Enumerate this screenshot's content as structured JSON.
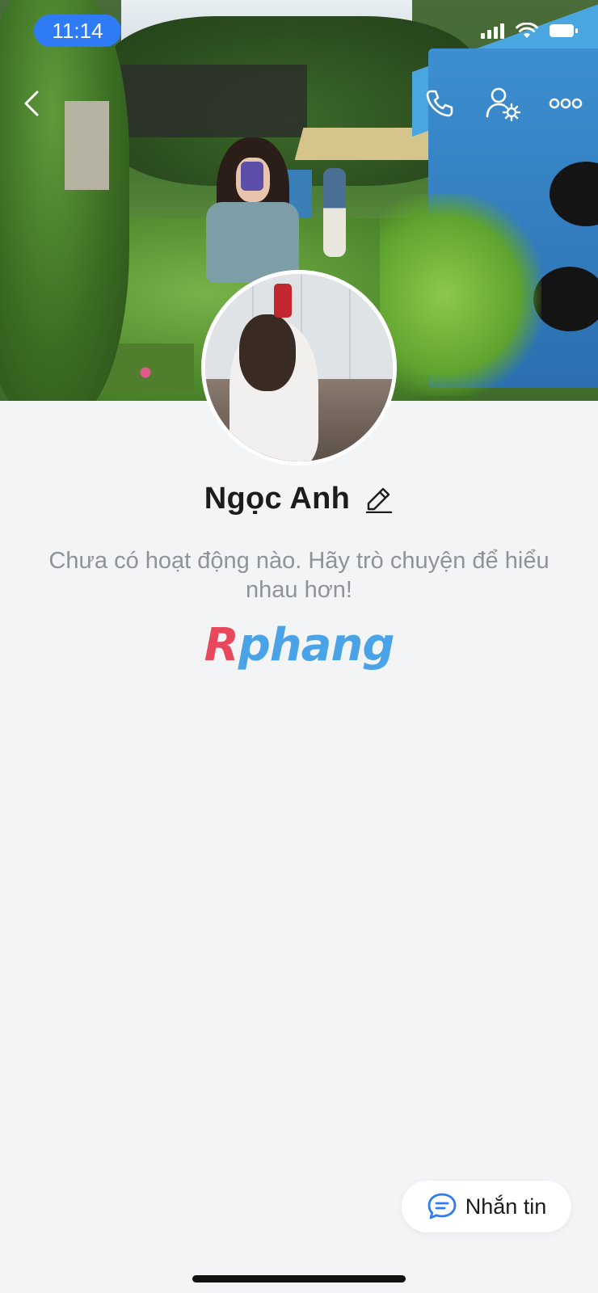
{
  "status_bar": {
    "time": "11:14"
  },
  "top_bar": {
    "icons": [
      "back-icon",
      "phone-call-icon",
      "profile-settings-icon",
      "more-options-icon"
    ]
  },
  "profile": {
    "name": "Ngọc Anh",
    "empty_activity_text": "Chưa có hoạt động nào. Hãy trò chuyện để hiểu nhau hơn!"
  },
  "watermark": {
    "first_letter": "R",
    "rest": "phang"
  },
  "message_button": {
    "label": "Nhắn tin"
  },
  "colors": {
    "accent": "#2f7bf5",
    "background": "#f3f4f6",
    "text_primary": "#1c1c1e",
    "text_secondary": "#8e9399"
  }
}
